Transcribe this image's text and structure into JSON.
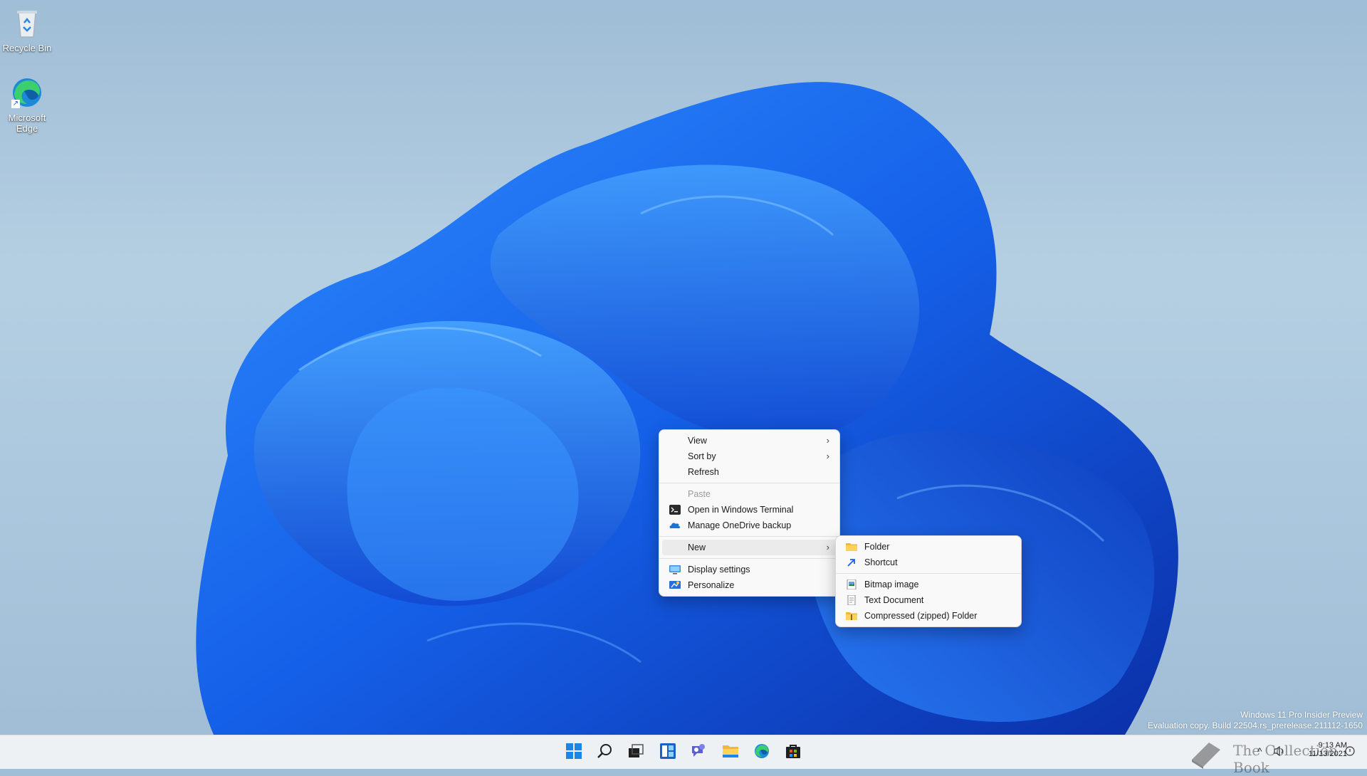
{
  "desktop": {
    "icons": [
      {
        "label": "Recycle Bin",
        "icon": "recycle-bin-icon"
      },
      {
        "label": "Microsoft Edge",
        "icon": "edge-icon"
      }
    ],
    "watermark": {
      "line1": "Windows 11 Pro Insider Preview",
      "line2": "Evaluation copy. Build 22504.rs_prerelease.211112-1650"
    },
    "logo_text": "The Collection Book"
  },
  "context_menu": {
    "items": [
      {
        "label": "View",
        "submenu": true
      },
      {
        "label": "Sort by",
        "submenu": true
      },
      {
        "label": "Refresh"
      },
      {
        "label": "Paste",
        "disabled": true
      },
      {
        "label": "Open in Windows Terminal",
        "icon": "terminal-icon"
      },
      {
        "label": "Manage OneDrive backup",
        "icon": "onedrive-icon"
      },
      {
        "label": "New",
        "submenu": true,
        "active": true
      },
      {
        "label": "Display settings",
        "icon": "display-icon"
      },
      {
        "label": "Personalize",
        "icon": "personalize-icon"
      }
    ]
  },
  "new_submenu": {
    "items": [
      {
        "label": "Folder",
        "icon": "folder-icon"
      },
      {
        "label": "Shortcut",
        "icon": "shortcut-icon"
      },
      {
        "label": "Bitmap image",
        "icon": "bitmap-icon"
      },
      {
        "label": "Text Document",
        "icon": "text-document-icon"
      },
      {
        "label": "Compressed (zipped) Folder",
        "icon": "zip-folder-icon"
      }
    ]
  },
  "taskbar": {
    "apps": [
      "start-icon",
      "search-icon",
      "task-view-icon",
      "widgets-icon",
      "chat-icon",
      "file-explorer-icon",
      "edge-icon",
      "store-icon"
    ],
    "time": "9:13 AM",
    "date": "11/13/2021"
  },
  "colors": {
    "accent": "#1b62e6",
    "menu_bg": "#f9f9f9",
    "taskbar_bg": "#eef1f4"
  }
}
